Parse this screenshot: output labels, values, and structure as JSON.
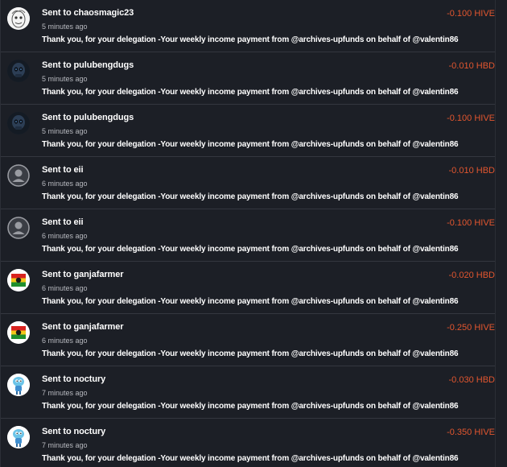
{
  "transactions": [
    {
      "title": "Sent to chaosmagic23",
      "time": "5 minutes ago",
      "amount": "-0.100 HIVE",
      "memo": "Thank you, for your delegation -Your weekly income payment from @archives-upfunds on behalf of @valentin86",
      "avatar": "sketch-face-avatar"
    },
    {
      "title": "Sent to pulubengdugs",
      "time": "5 minutes ago",
      "amount": "-0.010 HBD",
      "memo": "Thank you, for your delegation -Your weekly income payment from @archives-upfunds on behalf of @valentin86",
      "avatar": "dark-skull-avatar"
    },
    {
      "title": "Sent to pulubengdugs",
      "time": "5 minutes ago",
      "amount": "-0.100 HIVE",
      "memo": "Thank you, for your delegation -Your weekly income payment from @archives-upfunds on behalf of @valentin86",
      "avatar": "dark-skull-avatar"
    },
    {
      "title": "Sent to eii",
      "time": "6 minutes ago",
      "amount": "-0.010 HBD",
      "memo": "Thank you, for your delegation -Your weekly income payment from @archives-upfunds on behalf of @valentin86",
      "avatar": "default-user-avatar"
    },
    {
      "title": "Sent to eii",
      "time": "6 minutes ago",
      "amount": "-0.100 HIVE",
      "memo": "Thank you, for your delegation -Your weekly income payment from @archives-upfunds on behalf of @valentin86",
      "avatar": "default-user-avatar"
    },
    {
      "title": "Sent to ganjafarmer",
      "time": "6 minutes ago",
      "amount": "-0.020 HBD",
      "memo": "Thank you, for your delegation -Your weekly income payment from @archives-upfunds on behalf of @valentin86",
      "avatar": "rasta-flag-avatar"
    },
    {
      "title": "Sent to ganjafarmer",
      "time": "6 minutes ago",
      "amount": "-0.250 HIVE",
      "memo": "Thank you, for your delegation -Your weekly income payment from @archives-upfunds on behalf of @valentin86",
      "avatar": "rasta-flag-avatar"
    },
    {
      "title": "Sent to noctury",
      "time": "7 minutes ago",
      "amount": "-0.030 HBD",
      "memo": "Thank you, for your delegation -Your weekly income payment from @archives-upfunds on behalf of @valentin86",
      "avatar": "cartoon-character-avatar"
    },
    {
      "title": "Sent to noctury",
      "time": "7 minutes ago",
      "amount": "-0.350 HIVE",
      "memo": "Thank you, for your delegation -Your weekly income payment from @archives-upfunds on behalf of @valentin86",
      "avatar": "cartoon-character-avatar"
    }
  ],
  "colors": {
    "background": "#1c1f26",
    "divider": "#34373f",
    "amount": "#e2562f",
    "text": "#ffffff",
    "muted": "#b7b9bf"
  }
}
